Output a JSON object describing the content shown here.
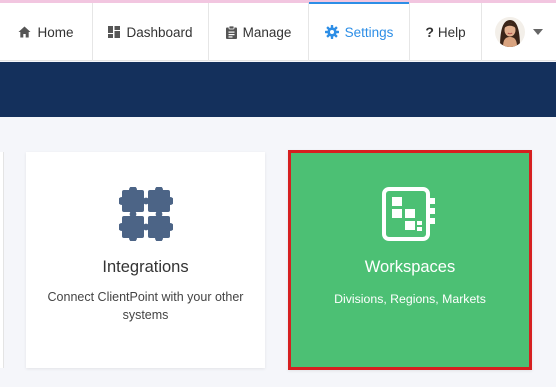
{
  "nav": {
    "items": [
      {
        "label": "Home",
        "icon": "home-icon"
      },
      {
        "label": "Dashboard",
        "icon": "dashboard-icon"
      },
      {
        "label": "Manage",
        "icon": "clipboard-icon"
      },
      {
        "label": "Settings",
        "icon": "gear-icon",
        "active": true
      },
      {
        "label": "Help",
        "icon": "question-icon"
      }
    ],
    "user_menu_icon": "chevron-down-icon"
  },
  "cards": [
    {
      "title": "Integrations",
      "description": "Connect ClientPoint with your other systems",
      "icon": "puzzle-icon"
    },
    {
      "title": "Workspaces",
      "description": "Divisions, Regions, Markets",
      "icon": "workspaces-icon",
      "highlighted": true
    }
  ],
  "colors": {
    "accent": "#2d8ee6",
    "banner": "#14305c",
    "workspace_card": "#4cc074",
    "highlight_border": "#d62020",
    "puzzle_icon": "#4c6486"
  }
}
